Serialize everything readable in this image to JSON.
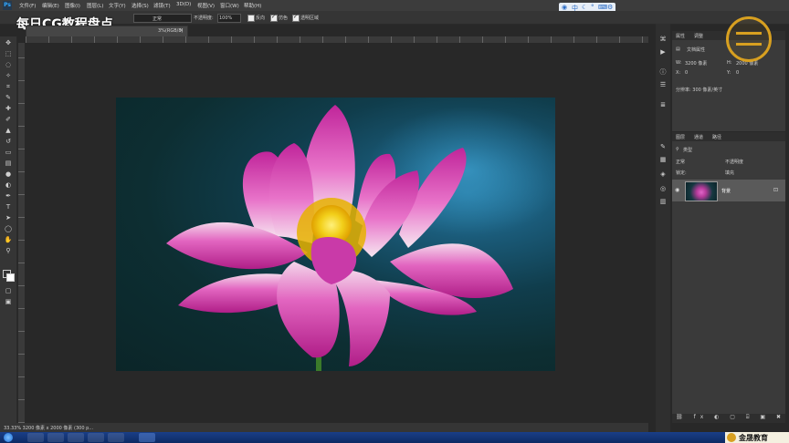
{
  "app": {
    "logo": "Ps",
    "menu": [
      "文件(F)",
      "编辑(E)",
      "图像(I)",
      "图层(L)",
      "文字(Y)",
      "选择(S)",
      "滤镜(T)",
      "3D(D)",
      "视图(V)",
      "窗口(W)",
      "帮助(H)"
    ]
  },
  "options": {
    "mode_label": "正常",
    "opacity_label": "不透明度:",
    "opacity_value": "100%",
    "reverse_label": "反向",
    "dither_label": "仿色",
    "transparency_label": "透明区域"
  },
  "watermark": "每日CG教程盘点",
  "document": {
    "tab_title": "3%(RGB/8)",
    "close_glyph": "×"
  },
  "status": {
    "text": "33.33%   3200 像素 x 2000 像素 (300 p..."
  },
  "properties": {
    "tabs": [
      "属性",
      "调整"
    ],
    "title": "文档属性",
    "w_label": "W:",
    "w_value": "3200 像素",
    "h_label": "H:",
    "h_value": "2000 像素",
    "x_label": "X:",
    "x_value": "0",
    "y_label": "Y:",
    "y_value": "0",
    "resolution": "分辨率: 300 像素/英寸"
  },
  "layers": {
    "tabs": [
      "图层",
      "通道",
      "路径"
    ],
    "kind_label": "类型",
    "blend_label": "正常",
    "opacity_label": "不透明度",
    "lock_label": "锁定:",
    "fill_label": "填充",
    "layer_name": "背景"
  },
  "brand": {
    "text": "金晟教育"
  },
  "icons": {
    "toolbar": [
      "move-icon",
      "marquee-icon",
      "lasso-icon",
      "magic-wand-icon",
      "crop-icon",
      "eyedropper-icon",
      "healing-icon",
      "brush-icon",
      "stamp-icon",
      "history-brush-icon",
      "eraser-icon",
      "gradient-icon",
      "blur-icon",
      "dodge-icon",
      "pen-icon",
      "text-icon",
      "path-select-icon",
      "shape-icon",
      "hand-icon",
      "zoom-icon"
    ]
  },
  "colors": {
    "app_bg": "#282828",
    "panel": "#3a3a3a",
    "accent_gold": "#d8a020",
    "taskbar": "#1a3f88"
  }
}
